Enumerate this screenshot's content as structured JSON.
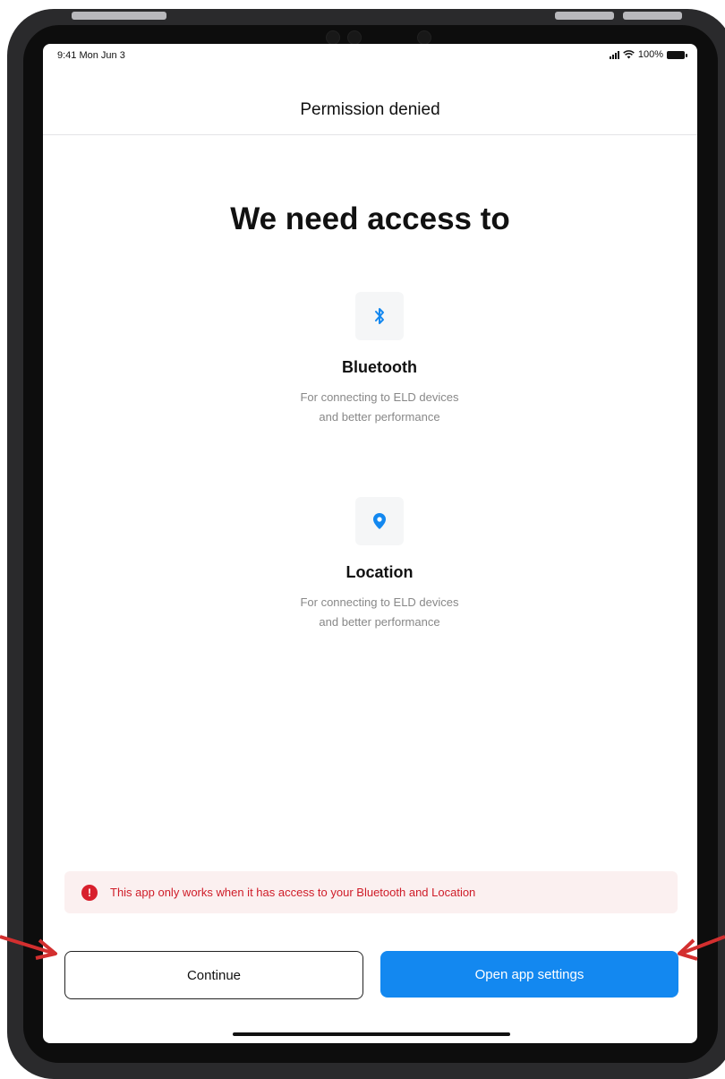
{
  "status_bar": {
    "time": "9:41 Mon Jun 3",
    "battery": "100%"
  },
  "nav": {
    "title": "Permission denied"
  },
  "main": {
    "heading": "We need access to",
    "permissions": [
      {
        "icon": "bluetooth-icon",
        "title": "Bluetooth",
        "desc_line1": "For connecting to ELD devices",
        "desc_line2": "and better performance"
      },
      {
        "icon": "location-pin-icon",
        "title": "Location",
        "desc_line1": "For connecting to ELD devices",
        "desc_line2": "and better performance"
      }
    ]
  },
  "alert": {
    "icon": "error-icon",
    "text": "This app only works when it has access to your Bluetooth and Location"
  },
  "buttons": {
    "continue": "Continue",
    "open_settings": "Open app settings"
  },
  "colors": {
    "accent": "#1388f0",
    "error": "#d8202d",
    "annotation_arrow": "#d32f2f"
  }
}
